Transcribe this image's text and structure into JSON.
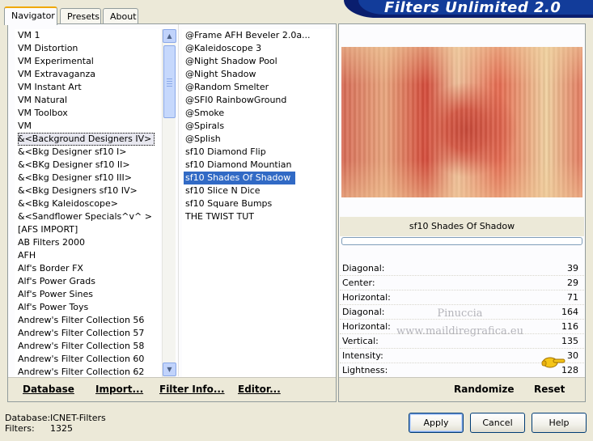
{
  "window": {
    "banner_title": "Filters Unlimited 2.0"
  },
  "tabs": [
    {
      "label": "Navigator",
      "active": true
    },
    {
      "label": "Presets",
      "active": false
    },
    {
      "label": "About",
      "active": false
    }
  ],
  "categories": [
    "VM 1",
    "VM Distortion",
    "VM Experimental",
    "VM Extravaganza",
    "VM Instant Art",
    "VM Natural",
    "VM Toolbox",
    "VM",
    "&<Background Designers IV>",
    "&<Bkg Designer sf10 I>",
    "&<BKg Designer sf10 II>",
    "&<Bkg Designer sf10 III>",
    "&<Bkg Designers sf10 IV>",
    "&<Bkg Kaleidoscope>",
    "&<Sandflower Specials^v^ >",
    "[AFS IMPORT]",
    "AB Filters 2000",
    "AFH",
    "Alf's Border FX",
    "Alf's Power Grads",
    "Alf's Power Sines",
    "Alf's Power Toys",
    "Andrew's Filter Collection 56",
    "Andrew's Filter Collection 57",
    "Andrew's Filter Collection 58",
    "Andrew's Filter Collection 60",
    "Andrew's Filter Collection 62"
  ],
  "selected_category": "&<Background Designers IV>",
  "filters": [
    "@Frame AFH Beveler 2.0a...",
    "@Kaleidoscope 3",
    "@Night Shadow Pool",
    "@Night Shadow",
    "@Random Smelter",
    "@SFI0 RainbowGround",
    "@Smoke",
    "@Spirals",
    "@Splish",
    "sf10 Diamond Flip",
    "sf10 Diamond Mountian",
    "sf10 Shades Of Shadow",
    "sf10 Slice N Dice",
    "sf10 Square Bumps",
    "THE TWIST TUT"
  ],
  "selected_filter": "sf10 Shades Of Shadow",
  "left_links": {
    "database": "Database",
    "import": "Import...",
    "filter_info": "Filter Info...",
    "editor": "Editor..."
  },
  "preview": {
    "filter_name": "sf10 Shades Of Shadow",
    "progress": 0
  },
  "params": [
    {
      "label": "Diagonal:",
      "value": "39"
    },
    {
      "label": "Center:",
      "value": "29"
    },
    {
      "label": "Horizontal:",
      "value": "71"
    },
    {
      "label": "Diagonal:",
      "value": "164"
    },
    {
      "label": "Horizontal:",
      "value": "116"
    },
    {
      "label": "Vertical:",
      "value": "135"
    },
    {
      "label": "Intensity:",
      "value": "30"
    },
    {
      "label": "Lightness:",
      "value": "128"
    }
  ],
  "watermark": {
    "line1": "Pinuccia",
    "line2": "www.maildiregrafica.eu"
  },
  "right_links": {
    "randomize": "Randomize",
    "reset": "Reset"
  },
  "status": {
    "database_label": "Database:",
    "database_value": "ICNET-Filters",
    "filters_label": "Filters:",
    "filters_value": "1325"
  },
  "buttons": {
    "apply": "Apply",
    "cancel": "Cancel",
    "help": "Help"
  },
  "icons": {
    "scroll_up": "scroll-up-arrow-icon",
    "scroll_down": "scroll-down-arrow-icon",
    "pointer": "pointing-hand-icon"
  },
  "colors": {
    "selection": "#316ac5",
    "banner": "#123c9a",
    "tab_accent": "#f0a800"
  }
}
